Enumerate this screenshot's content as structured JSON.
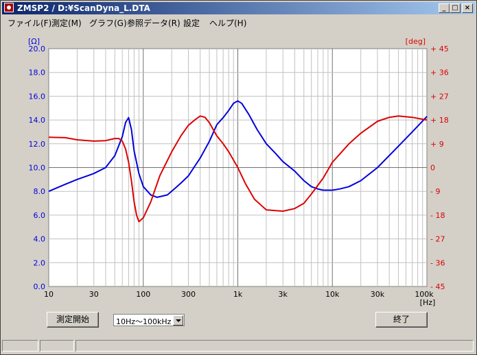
{
  "window": {
    "title": "ZMSP2 / D:¥ScanDyna_L.DTA"
  },
  "titlebar_buttons": {
    "minimize": "_",
    "maximize": "□",
    "close": "×"
  },
  "menu": [
    {
      "label": "ファイル(F)"
    },
    {
      "label": "測定(M)"
    },
    {
      "label": "グラフ(G)"
    },
    {
      "label": "参照データ(R)"
    },
    {
      "label": "設定"
    },
    {
      "label": "ヘルプ(H)"
    }
  ],
  "colors": {
    "impedance": "#0000dd",
    "phase": "#dd0000",
    "grid": "#a0a0a0"
  },
  "chart_data": {
    "type": "line",
    "x_axis": {
      "scale": "log",
      "range": [
        10,
        100000
      ],
      "unit": "[Hz]",
      "tick_labels": [
        "10",
        "30",
        "100",
        "300",
        "1k",
        "3k",
        "10k",
        "30k",
        "100k"
      ],
      "tick_values": [
        10,
        30,
        100,
        300,
        1000,
        3000,
        10000,
        30000,
        100000
      ]
    },
    "y_left": {
      "unit": "[Ω]",
      "range": [
        0,
        20
      ],
      "tick_labels": [
        "20.0",
        "18.0",
        "16.0",
        "14.0",
        "12.0",
        "10.0",
        "8.0",
        "6.0",
        "4.0",
        "2.0",
        "0.0"
      ]
    },
    "y_right": {
      "unit": "[deg]",
      "range": [
        -45,
        45
      ],
      "tick_labels": [
        "+ 45",
        "+ 36",
        "+ 27",
        "+ 18",
        "+ 9",
        "0",
        "- 9",
        "- 18",
        "- 27",
        "- 36",
        "- 45"
      ]
    },
    "grid": true,
    "series": [
      {
        "axis": "left",
        "points": [
          [
            10,
            8.0
          ],
          [
            15,
            8.6
          ],
          [
            20,
            9.0
          ],
          [
            30,
            9.5
          ],
          [
            40,
            10.0
          ],
          [
            50,
            11.0
          ],
          [
            60,
            12.6
          ],
          [
            65,
            13.8
          ],
          [
            70,
            14.2
          ],
          [
            75,
            13.2
          ],
          [
            80,
            11.4
          ],
          [
            90,
            9.5
          ],
          [
            100,
            8.4
          ],
          [
            120,
            7.7
          ],
          [
            140,
            7.5
          ],
          [
            180,
            7.7
          ],
          [
            220,
            8.3
          ],
          [
            250,
            8.7
          ],
          [
            300,
            9.3
          ],
          [
            400,
            10.8
          ],
          [
            500,
            12.2
          ],
          [
            600,
            13.6
          ],
          [
            700,
            14.2
          ],
          [
            800,
            14.8
          ],
          [
            900,
            15.4
          ],
          [
            1000,
            15.6
          ],
          [
            1100,
            15.4
          ],
          [
            1300,
            14.5
          ],
          [
            1600,
            13.2
          ],
          [
            2000,
            12.0
          ],
          [
            2500,
            11.2
          ],
          [
            3000,
            10.5
          ],
          [
            4000,
            9.7
          ],
          [
            5000,
            8.9
          ],
          [
            6000,
            8.4
          ],
          [
            7000,
            8.2
          ],
          [
            8000,
            8.1
          ],
          [
            10000,
            8.1
          ],
          [
            12000,
            8.2
          ],
          [
            15000,
            8.4
          ],
          [
            20000,
            8.9
          ],
          [
            30000,
            10.0
          ],
          [
            50000,
            11.8
          ],
          [
            70000,
            13.0
          ],
          [
            100000,
            14.3
          ]
        ]
      },
      {
        "axis": "right",
        "points": [
          [
            10,
            11.5
          ],
          [
            15,
            11.3
          ],
          [
            20,
            10.5
          ],
          [
            30,
            10.0
          ],
          [
            40,
            10.2
          ],
          [
            50,
            11.0
          ],
          [
            55,
            11.0
          ],
          [
            60,
            10.0
          ],
          [
            65,
            7.0
          ],
          [
            70,
            2.0
          ],
          [
            75,
            -5.0
          ],
          [
            80,
            -13.0
          ],
          [
            85,
            -18.0
          ],
          [
            90,
            -20.5
          ],
          [
            100,
            -19.0
          ],
          [
            120,
            -13.0
          ],
          [
            150,
            -3.0
          ],
          [
            200,
            6.0
          ],
          [
            250,
            12.0
          ],
          [
            300,
            16.0
          ],
          [
            350,
            18.0
          ],
          [
            400,
            19.5
          ],
          [
            450,
            19.0
          ],
          [
            500,
            17.0
          ],
          [
            600,
            12.0
          ],
          [
            700,
            9.0
          ],
          [
            800,
            6.0
          ],
          [
            1000,
            0.0
          ],
          [
            1200,
            -6.0
          ],
          [
            1500,
            -12.0
          ],
          [
            2000,
            -16.0
          ],
          [
            3000,
            -16.5
          ],
          [
            4000,
            -15.5
          ],
          [
            5000,
            -13.5
          ],
          [
            6000,
            -10.0
          ],
          [
            8000,
            -4.0
          ],
          [
            10000,
            2.0
          ],
          [
            15000,
            9.0
          ],
          [
            20000,
            13.0
          ],
          [
            30000,
            17.5
          ],
          [
            40000,
            19.0
          ],
          [
            50000,
            19.5
          ],
          [
            70000,
            19.0
          ],
          [
            100000,
            18.0
          ]
        ]
      }
    ]
  },
  "controls": {
    "start_button": "測定開始",
    "range_select": "10Hz〜100kHz",
    "end_button": "終了"
  }
}
